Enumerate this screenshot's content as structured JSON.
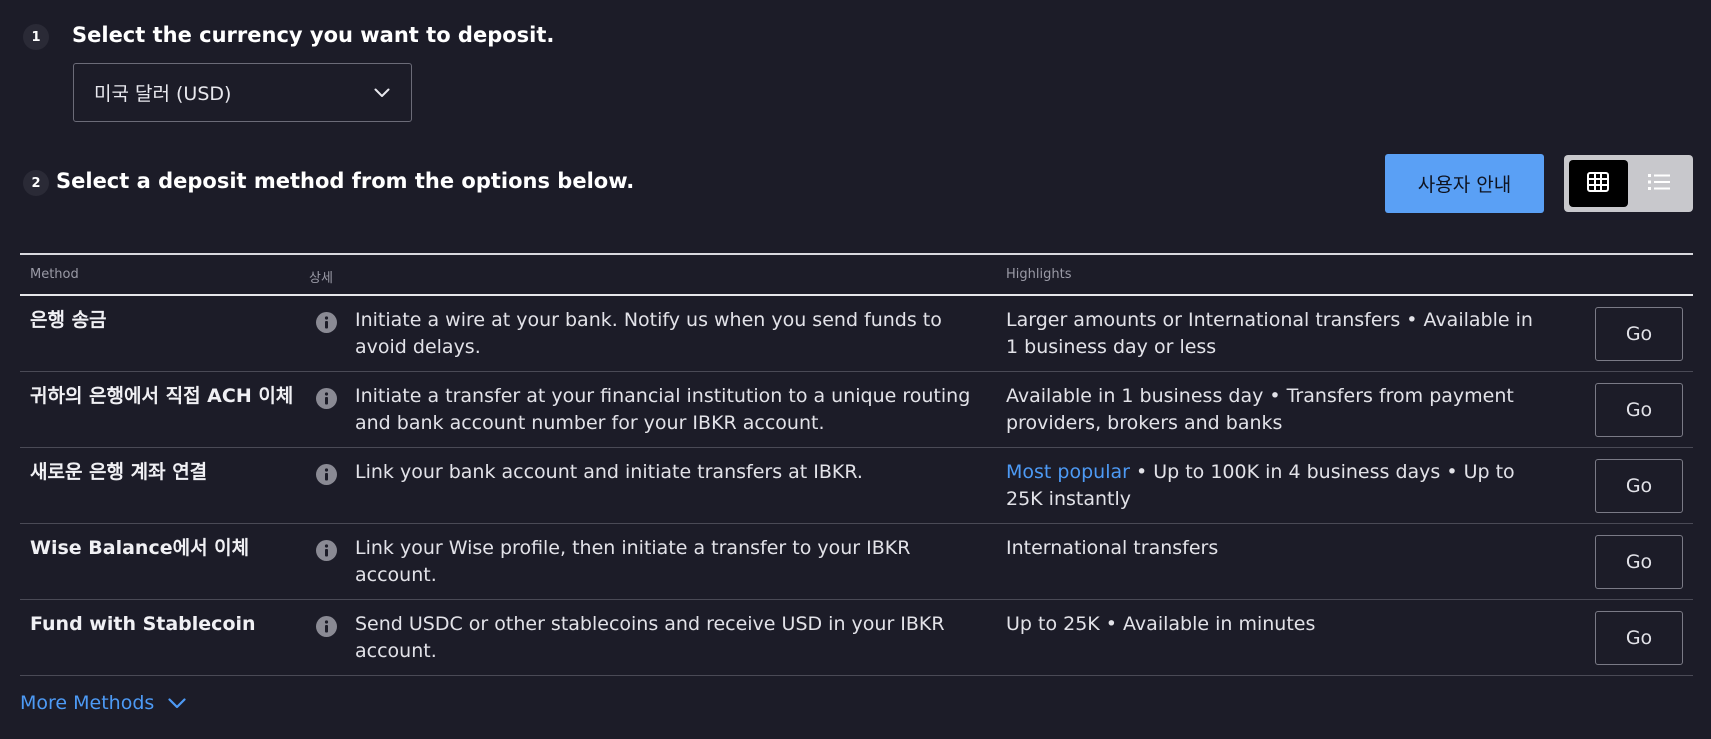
{
  "step1": {
    "number": "1",
    "title": "Select the currency you want to deposit."
  },
  "currency_select": {
    "value": "미국 달러 (USD)",
    "icon": "chevron-down-icon"
  },
  "step2": {
    "number": "2",
    "title": "Select a deposit method from the options below."
  },
  "guide_button": {
    "label": "사용자 안내"
  },
  "view_toggle": {
    "options": [
      "grid-view-icon",
      "list-view-icon"
    ],
    "selected": "grid-view-icon"
  },
  "table": {
    "headers": {
      "method": "Method",
      "detail": "상세",
      "highlights": "Highlights"
    },
    "rows": [
      {
        "method": "은행 송금",
        "detail": "Initiate a wire at your bank. Notify us when you send funds to avoid delays.",
        "highlight_accent": "",
        "highlights": "Larger amounts or International transfers • Available in 1 business day or less",
        "go_label": "Go"
      },
      {
        "method": "귀하의 은행에서 직접 ACH 이체",
        "detail": "Initiate a transfer at your financial institution to a unique routing and bank account number for your IBKR account.",
        "highlight_accent": "",
        "highlights": "Available in 1 business day • Transfers from payment providers, brokers and banks",
        "go_label": "Go"
      },
      {
        "method": "새로운 은행 계좌 연결",
        "detail": "Link your bank account and initiate transfers at IBKR.",
        "highlight_accent": "Most popular",
        "highlights": " • Up to 100K in 4 business days • Up to 25K instantly",
        "go_label": "Go"
      },
      {
        "method": "Wise Balance에서 이체",
        "detail": "Link your Wise profile, then initiate a transfer to your IBKR account.",
        "highlight_accent": "",
        "highlights": "International transfers",
        "go_label": "Go"
      },
      {
        "method": "Fund with Stablecoin",
        "detail": "Send USDC or other stablecoins and receive USD in your IBKR account.",
        "highlight_accent": "",
        "highlights": "Up to 25K • Available in minutes",
        "go_label": "Go"
      }
    ]
  },
  "more_methods": {
    "label": "More Methods",
    "icon": "chevron-down-icon"
  },
  "colors": {
    "background": "#1c1c28",
    "accent_blue": "#4d9af5",
    "guide_button_bg": "#5aa0f5"
  }
}
